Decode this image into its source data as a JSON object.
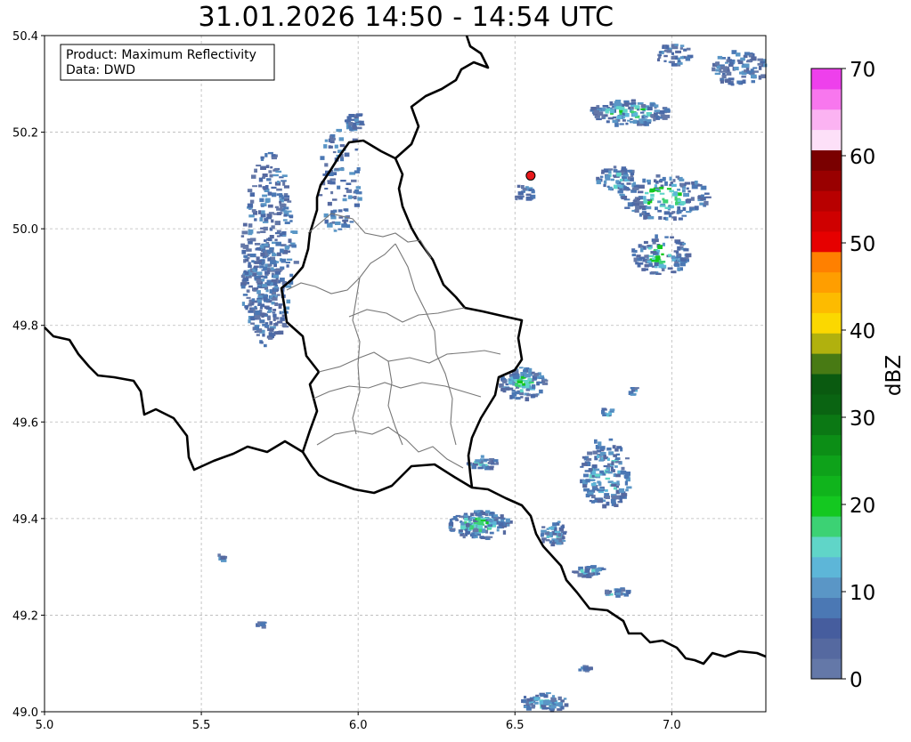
{
  "title": "31.01.2026 14:50 - 14:54 UTC",
  "info_box": {
    "product": "Product: Maximum Reflectivity",
    "data": "Data: DWD"
  },
  "map": {
    "lon_range": [
      5.0,
      7.3
    ],
    "lat_range": [
      49.0,
      50.4
    ],
    "x_ticks": [
      "5.0",
      "5.5",
      "6.0",
      "6.5",
      "7.0"
    ],
    "y_ticks": [
      "49.0",
      "49.2",
      "49.4",
      "49.6",
      "49.8",
      "50.0",
      "50.2",
      "50.4"
    ],
    "grid": true,
    "marker": {
      "name": "radar-site-marker",
      "lon": 6.55,
      "lat": 50.11,
      "color": "#e8191c"
    }
  },
  "colorbar": {
    "label": "dBZ",
    "range": [
      0,
      70
    ],
    "tick_labels": [
      "0",
      "10",
      "20",
      "30",
      "40",
      "50",
      "60",
      "70"
    ],
    "colors": [
      "#6478a8",
      "#5569a0",
      "#465d9e",
      "#4b78b4",
      "#5a96c6",
      "#5db6d8",
      "#60d5c8",
      "#3cd274",
      "#14c820",
      "#10b41c",
      "#0ea21a",
      "#0c8e16",
      "#0b7814",
      "#0a6412",
      "#0a5a10",
      "#487a14",
      "#b1b10e",
      "#fbd800",
      "#fdbb00",
      "#ff9e00",
      "#ff8000",
      "#e60000",
      "#cf0000",
      "#b80000",
      "#990000",
      "#7a0000",
      "#fde0f8",
      "#fbb3f2",
      "#f877ee",
      "#ee40ec"
    ]
  }
}
